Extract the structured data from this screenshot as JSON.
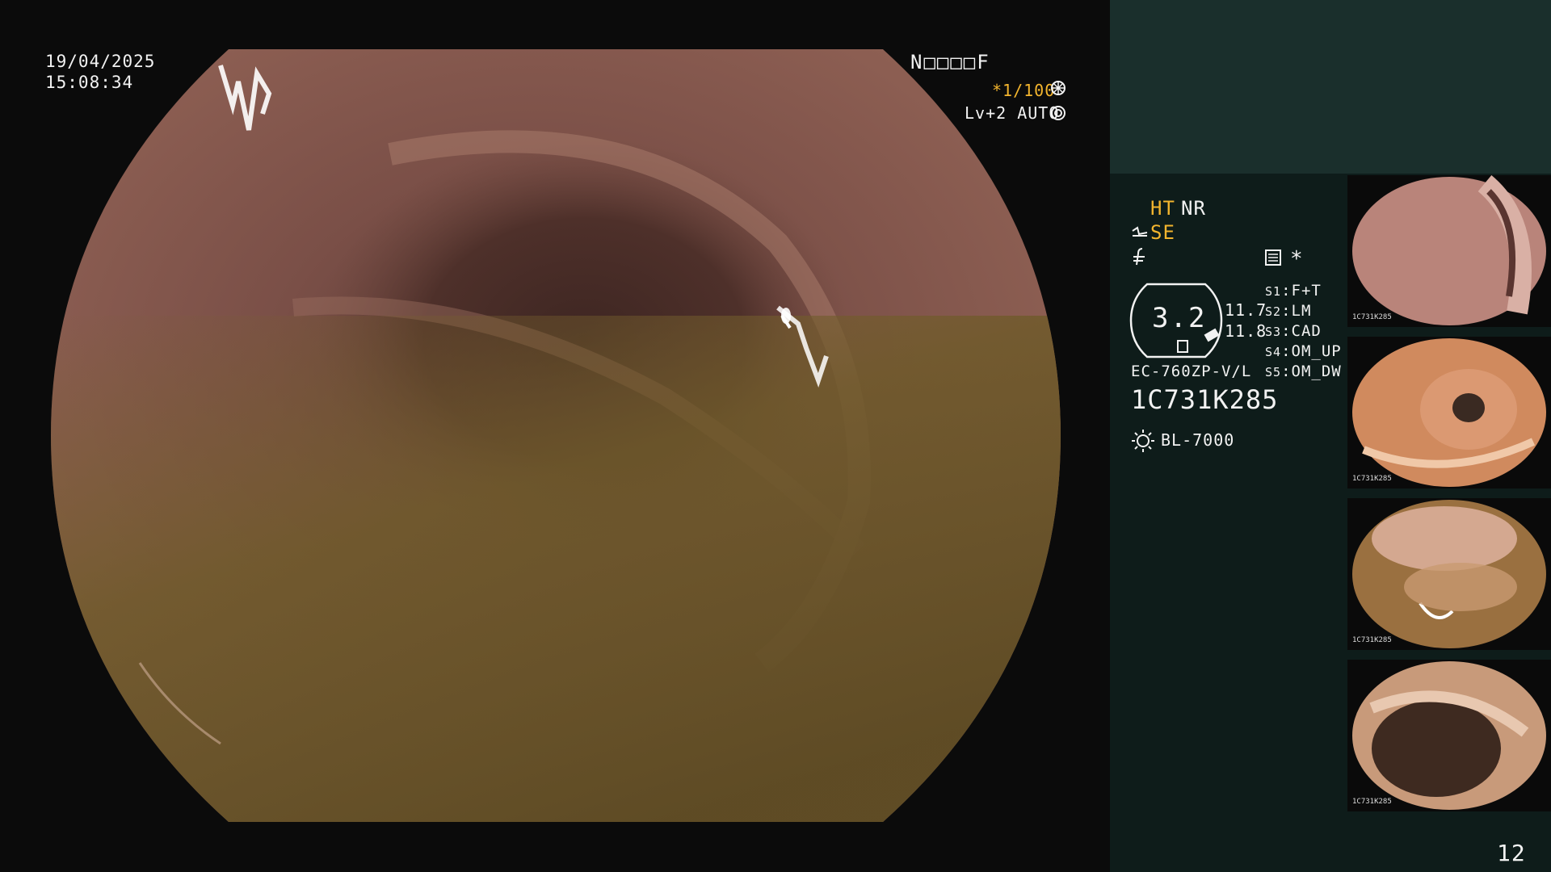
{
  "osd": {
    "date": "19/04/2025",
    "time": "15:08:34",
    "mode_code": "N□□□□F",
    "shutter": "*1/100",
    "level": "Lv+2 AUTO"
  },
  "panel": {
    "ht_label": "HT",
    "nr_label": "NR",
    "se_label": "SE",
    "asterisk": "*",
    "gauge_value": "3.2",
    "value_a": "11.7",
    "value_b": "11.8",
    "slots": [
      {
        "key": "S1",
        "value": "F+T"
      },
      {
        "key": "S2",
        "value": "LM"
      },
      {
        "key": "S3",
        "value": "CAD"
      },
      {
        "key": "S4",
        "value": "OM_UP"
      },
      {
        "key": "S5",
        "value": "OM_DW"
      }
    ],
    "scope_model": "EC-760ZP-V/L",
    "serial": "1C731K285",
    "light_source": "BL-7000"
  },
  "thumbnails": [
    {
      "serial": "1C731K285"
    },
    {
      "serial": "1C731K285"
    },
    {
      "serial": "1C731K285"
    },
    {
      "serial": "1C731K285"
    }
  ],
  "page_number": "12",
  "colors": {
    "osd_text": "#f2f2f2",
    "osd_accent": "#f3b52e",
    "panel_bg": "#0e1c1a",
    "panel_header_bg": "#1a2f2c"
  },
  "icons": [
    "shutter-icon",
    "auto-iris-icon",
    "structure-enhance-icon",
    "color-mode-icon",
    "memo-icon",
    "gauge-icon",
    "light-source-icon"
  ]
}
